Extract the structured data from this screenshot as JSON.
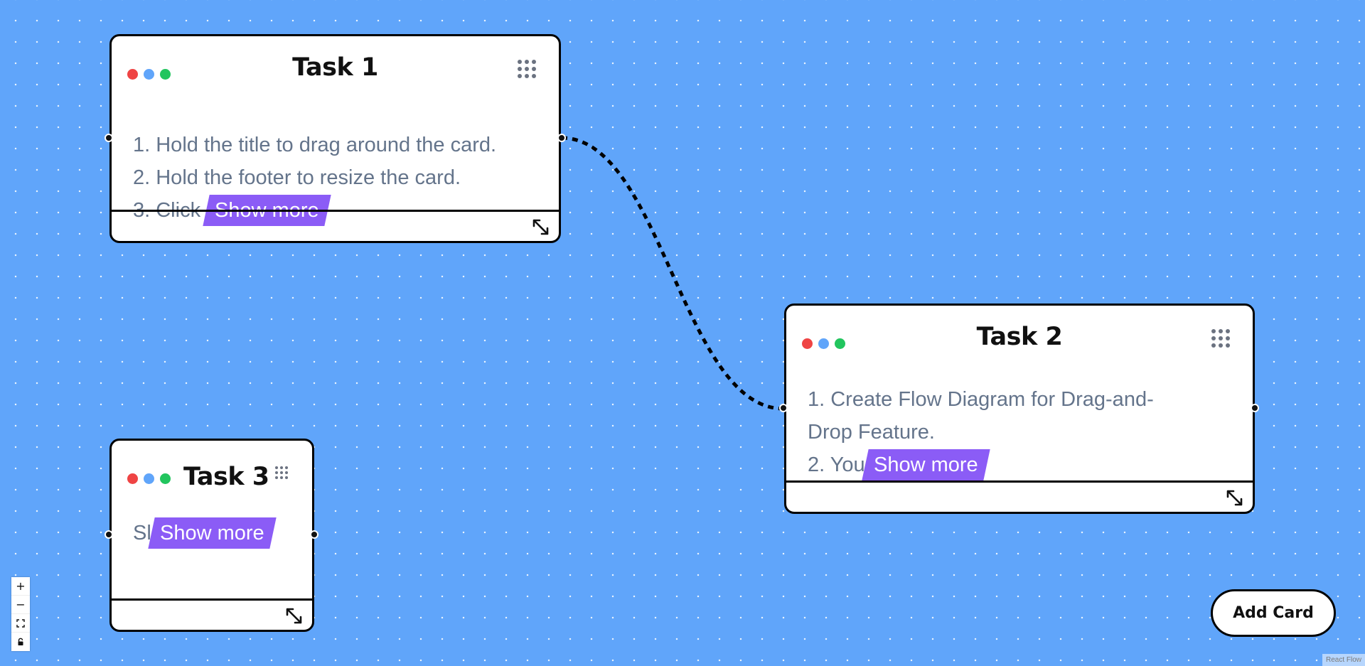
{
  "cards": [
    {
      "title": "Task 1",
      "lines": [
        "1. Hold the title to drag around the card.",
        "2. Hold the footer to resize the card.",
        "3. Click"
      ],
      "show_more": "Show more"
    },
    {
      "title": "Task 2",
      "lines": [
        "1. Create Flow Diagram for Drag-and-",
        "Drop Feature.",
        "2. You"
      ],
      "show_more": "Show more"
    },
    {
      "title": "Task 3",
      "lines": [
        "Sl"
      ],
      "show_more": "Show more"
    }
  ],
  "window_dot_colors": [
    "#ef4444",
    "#60a5fa",
    "#22c55e"
  ],
  "colors": {
    "canvas_background": "#60a5fa",
    "show_more_background": "#8b5cf6",
    "body_text": "#64748b"
  },
  "icons": {
    "drag_handle": "grip-dots-icon",
    "resize": "resize-diagonal-icon",
    "zoom_in": "plus-icon",
    "zoom_out": "minus-icon",
    "fit_view": "fit-view-icon",
    "lock": "lock-icon"
  },
  "controls": {
    "zoom_in": "+",
    "zoom_out": "−"
  },
  "add_card_label": "Add Card",
  "attribution": "React Flow"
}
